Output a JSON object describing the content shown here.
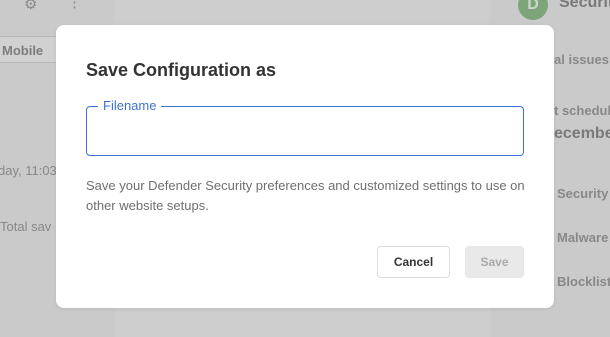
{
  "background": {
    "tab_mobile": "Mobile",
    "timestamp": "day, 11:03",
    "total_saved": "Total sav",
    "app_title": "Securit",
    "logo_letter": "D",
    "issues": "al issues",
    "schedule": "t schedul",
    "schedule_value": "ecember",
    "items": [
      "Security",
      "Malware",
      "Blocklist"
    ]
  },
  "modal": {
    "title": "Save Configuration as",
    "filename_label": "Filename",
    "filename_value": "",
    "description": "Save your Defender Security preferences and customized settings to use on other website setups.",
    "cancel_label": "Cancel",
    "save_label": "Save"
  },
  "colors": {
    "accent": "#3f73d1",
    "save_disabled_bg": "#e9e9e9",
    "overlay": "rgba(51,51,51,0.18)"
  }
}
